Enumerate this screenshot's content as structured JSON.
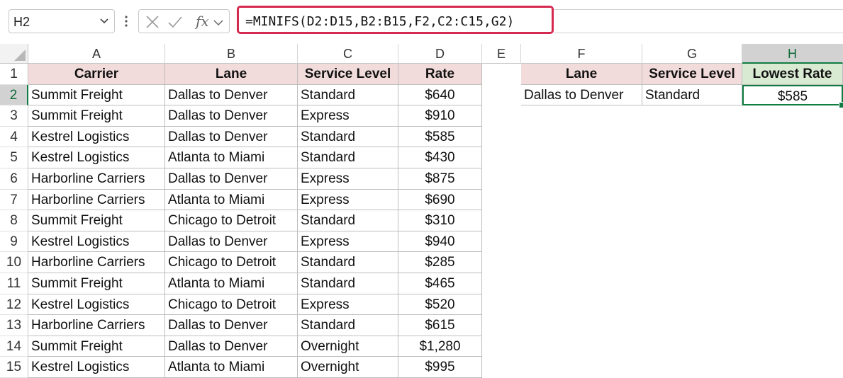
{
  "formula_bar": {
    "name_box": "H2",
    "fx_label": "fx",
    "formula": "=MINIFS(D2:D15,B2:B15,F2,C2:C15,G2)"
  },
  "columns": [
    "A",
    "B",
    "C",
    "D",
    "E",
    "F",
    "G",
    "H"
  ],
  "active_column": "H",
  "active_row": "2",
  "rows": [
    "1",
    "2",
    "3",
    "4",
    "5",
    "6",
    "7",
    "8",
    "9",
    "10",
    "11",
    "12",
    "13",
    "14",
    "15"
  ],
  "table": {
    "headers": [
      "Carrier",
      "Lane",
      "Service Level",
      "Rate"
    ],
    "data": [
      [
        "Summit Freight",
        "Dallas to Denver",
        "Standard",
        "$640"
      ],
      [
        "Summit Freight",
        "Dallas to Denver",
        "Express",
        "$910"
      ],
      [
        "Kestrel Logistics",
        "Dallas to Denver",
        "Standard",
        "$585"
      ],
      [
        "Kestrel Logistics",
        "Atlanta to Miami",
        "Standard",
        "$430"
      ],
      [
        "Harborline Carriers",
        "Dallas to Denver",
        "Express",
        "$875"
      ],
      [
        "Harborline Carriers",
        "Atlanta to Miami",
        "Express",
        "$690"
      ],
      [
        "Summit Freight",
        "Chicago to Detroit",
        "Standard",
        "$310"
      ],
      [
        "Kestrel Logistics",
        "Dallas to Denver",
        "Express",
        "$940"
      ],
      [
        "Harborline Carriers",
        "Chicago to Detroit",
        "Standard",
        "$285"
      ],
      [
        "Summit Freight",
        "Atlanta to Miami",
        "Standard",
        "$465"
      ],
      [
        "Kestrel Logistics",
        "Chicago to Detroit",
        "Express",
        "$520"
      ],
      [
        "Harborline Carriers",
        "Dallas to Denver",
        "Standard",
        "$615"
      ],
      [
        "Summit Freight",
        "Dallas to Denver",
        "Overnight",
        "$1,280"
      ],
      [
        "Kestrel Logistics",
        "Atlanta to Miami",
        "Overnight",
        "$995"
      ]
    ]
  },
  "lookup": {
    "headers": [
      "Lane",
      "Service Level",
      "Lowest Rate"
    ],
    "values": [
      "Dallas to Denver",
      "Standard",
      "$585"
    ]
  },
  "colors": {
    "header_fill": "#f2dcdb",
    "result_header_fill": "#d9ead3",
    "selection": "#107c41",
    "formula_highlight": "#d6294f"
  }
}
